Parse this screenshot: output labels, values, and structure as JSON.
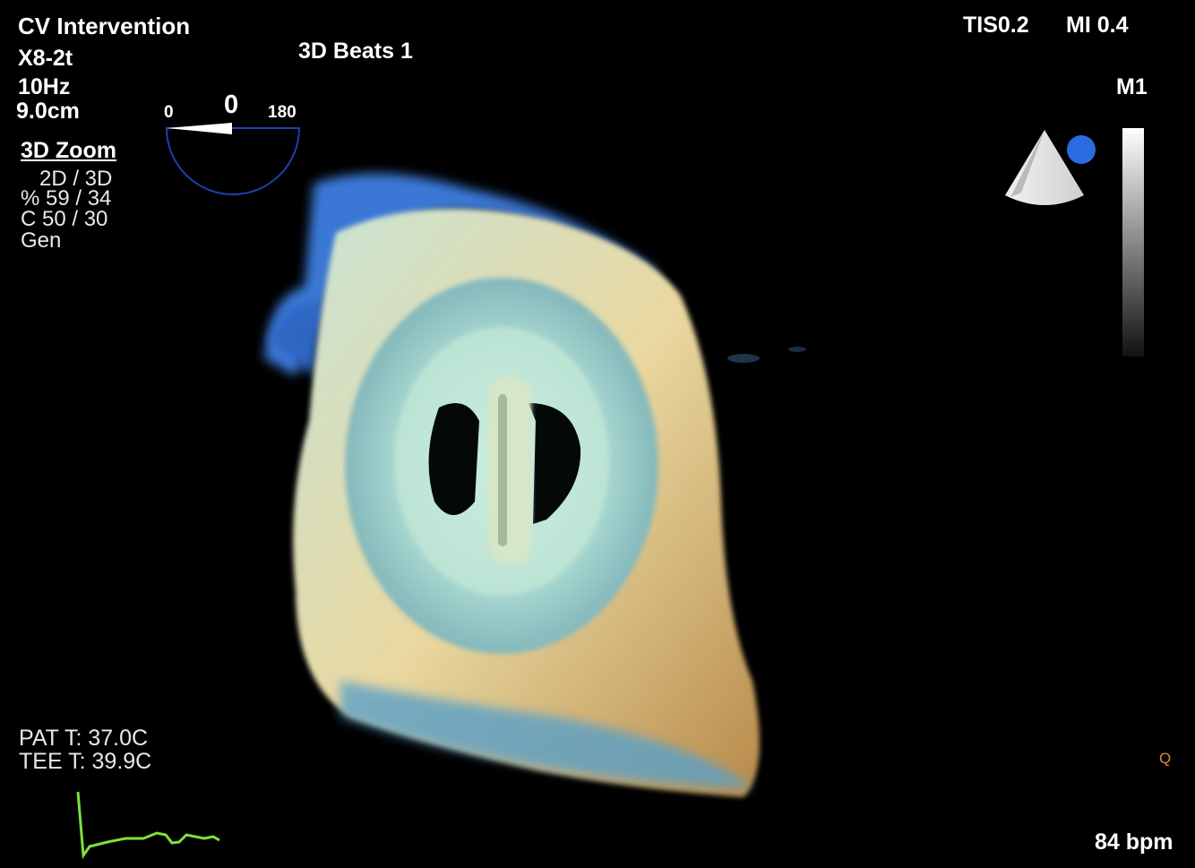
{
  "header": {
    "title": "CV Intervention",
    "probe": "X8-2t",
    "frame_rate": "10Hz",
    "depth": "9.0cm",
    "beats": "3D Beats 1",
    "tis": "TIS0.2",
    "mi": "MI 0.4",
    "map": "M1"
  },
  "angle": {
    "min": "0",
    "value": "0",
    "max": "180"
  },
  "mode": {
    "name": "3D Zoom",
    "lines": [
      "2D / 3D",
      "% 59 / 34",
      "C  50 / 30",
      "Gen"
    ]
  },
  "temps": {
    "patient": "PAT T: 37.0C",
    "tee": "TEE T: 39.9C"
  },
  "heart_rate": "84 bpm",
  "marker": "Q",
  "colors": {
    "ecg": "#7fe03a",
    "orientation_dot": "#2a6be0",
    "angle_arc": "#1f3fae"
  },
  "icons": [
    "probe-orientation-icon",
    "grayscale-bar-icon",
    "angle-dial-icon",
    "ecg-trace-icon"
  ]
}
